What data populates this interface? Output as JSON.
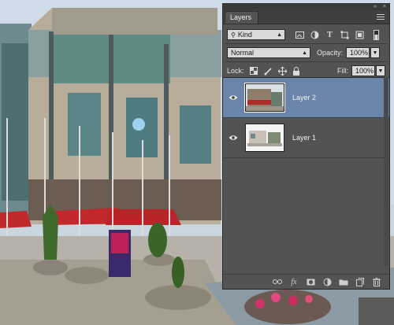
{
  "panel": {
    "tab_label": "Layers",
    "collapse_glyph": "«",
    "close_glyph": "×",
    "filter": {
      "label": "Kind",
      "icon": "search-icon"
    },
    "blend_mode": "Normal",
    "opacity_label": "Opacity:",
    "opacity_value": "100%",
    "lock_label": "Lock:",
    "fill_label": "Fill:",
    "fill_value": "100%"
  },
  "layers": [
    {
      "name": "Layer 2",
      "selected": true,
      "visible": true
    },
    {
      "name": "Layer 1",
      "selected": false,
      "visible": true
    }
  ],
  "footer_icons": [
    "link-layers-icon",
    "fx-icon",
    "add-mask-icon",
    "adjustment-layer-icon",
    "new-group-icon",
    "new-layer-icon",
    "delete-layer-icon"
  ],
  "colors": {
    "panel_bg": "#535353",
    "selected_layer": "#6a85a9"
  }
}
